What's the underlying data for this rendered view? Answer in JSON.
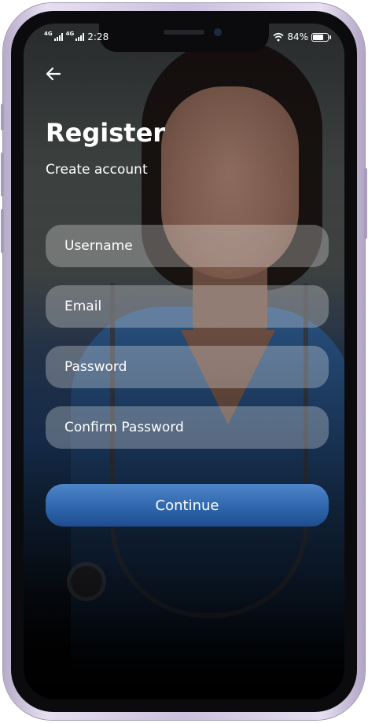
{
  "status_bar": {
    "network_1": "4G",
    "network_2": "4G",
    "time": "2:28",
    "battery_percent": "84%",
    "battery_level": 0.84
  },
  "header": {
    "back_icon": "arrow-left-icon",
    "title": "Register",
    "subtitle": "Create account"
  },
  "form": {
    "username_placeholder": "Username",
    "email_placeholder": "Email",
    "password_placeholder": "Password",
    "confirm_password_placeholder": "Confirm Password"
  },
  "actions": {
    "continue_label": "Continue"
  },
  "colors": {
    "primary_button": "#2f66ad",
    "text": "#ffffff"
  }
}
